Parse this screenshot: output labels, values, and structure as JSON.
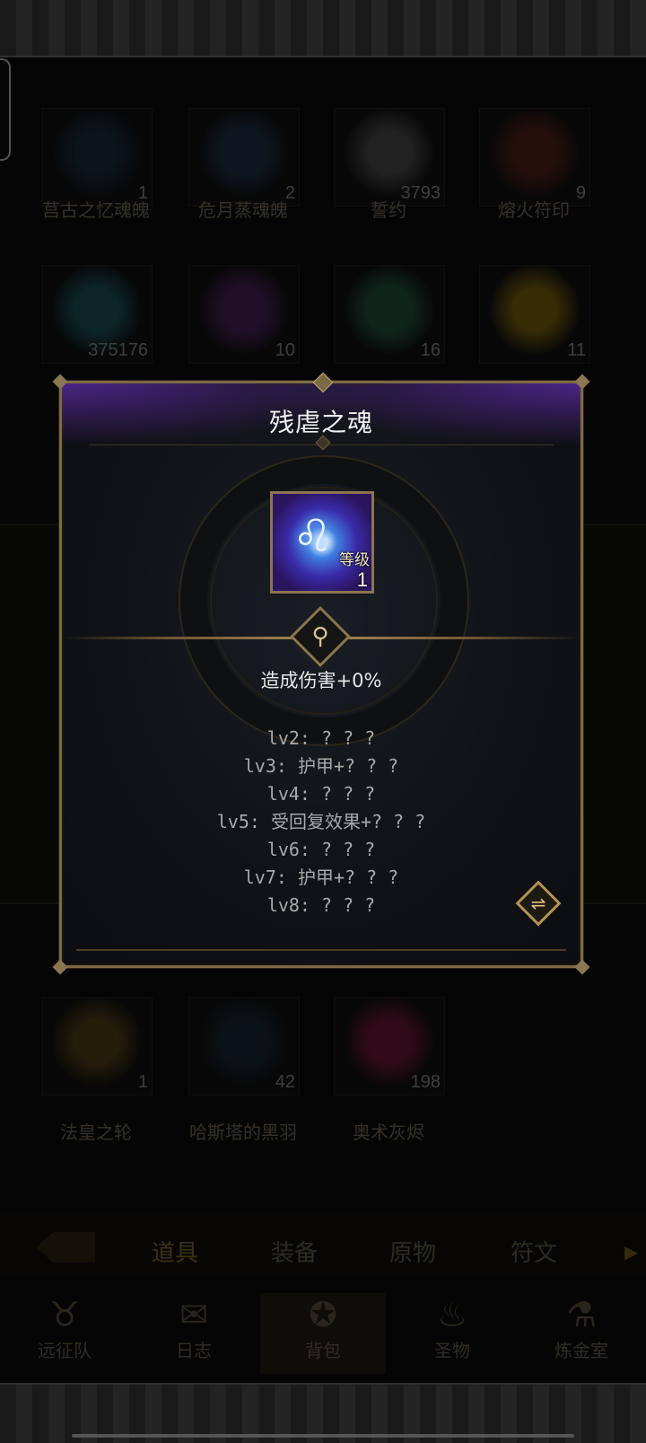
{
  "background_items": [
    {
      "name": "莒古之忆魂魄",
      "count": "1",
      "color": "#1b3a55"
    },
    {
      "name": "危月蒸魂魄",
      "count": "2",
      "color": "#244466"
    },
    {
      "name": "誓约",
      "count": "3793",
      "color": "#6a6a6a"
    },
    {
      "name": "熔火符印",
      "count": "9",
      "color": "#7a2a1a"
    },
    {
      "name": "",
      "count": "375176",
      "color": "#1e7a88"
    },
    {
      "name": "",
      "count": "10",
      "color": "#6a2a88"
    },
    {
      "name": "",
      "count": "16",
      "color": "#2a7a5a"
    },
    {
      "name": "",
      "count": "11",
      "color": "#b8900a"
    },
    {
      "name": "法皇之轮",
      "count": "1",
      "color": "#7a5a1a"
    },
    {
      "name": "哈斯塔的黑羽",
      "count": "42",
      "color": "#1a3344"
    },
    {
      "name": "奥术灰烬",
      "count": "198",
      "color": "#a01a4a"
    }
  ],
  "bottom_tabs": [
    "道具",
    "装备",
    "原物",
    "符文"
  ],
  "nav": [
    {
      "label": "远征队",
      "icon": "horned-helmet-icon"
    },
    {
      "label": "日志",
      "icon": "scroll-icon"
    },
    {
      "label": "背包",
      "icon": "bag-icon"
    },
    {
      "label": "圣物",
      "icon": "brazier-icon"
    },
    {
      "label": "炼金室",
      "icon": "alchemy-icon"
    }
  ],
  "modal": {
    "title": "残虐之魂",
    "level_label": "等级",
    "level_value": "1",
    "effect": "造成伤害+0%",
    "levels": [
      "lv2: ? ? ?",
      "lv3: 护甲+? ? ?",
      "lv4: ? ? ?",
      "lv5: 受回复效果+? ? ?",
      "lv6: ? ? ?",
      "lv7: 护甲+? ? ?",
      "lv8: ? ? ?"
    ]
  }
}
